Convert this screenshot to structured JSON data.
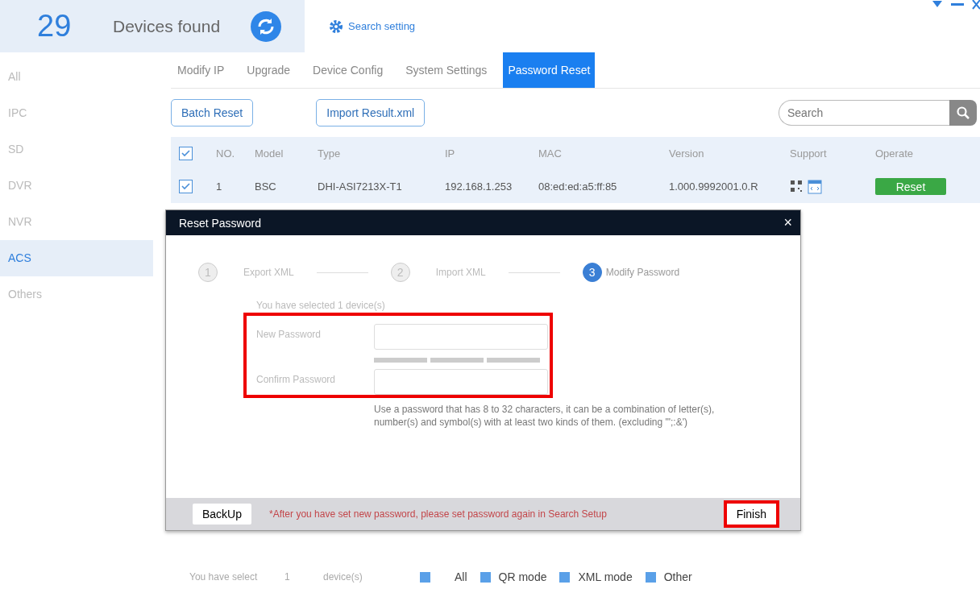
{
  "header": {
    "count": "29",
    "label": "Devices found",
    "search_setting": "Search setting"
  },
  "sidebar": {
    "items": [
      {
        "label": "All",
        "selected": false
      },
      {
        "label": "IPC",
        "selected": false
      },
      {
        "label": "SD",
        "selected": false
      },
      {
        "label": "DVR",
        "selected": false
      },
      {
        "label": "NVR",
        "selected": false
      },
      {
        "label": "ACS",
        "selected": true
      },
      {
        "label": "Others",
        "selected": false
      }
    ]
  },
  "tabs": [
    {
      "label": "Modify IP",
      "selected": false
    },
    {
      "label": "Upgrade",
      "selected": false
    },
    {
      "label": "Device Config",
      "selected": false
    },
    {
      "label": "System Settings",
      "selected": false
    },
    {
      "label": "Password Reset",
      "selected": true
    }
  ],
  "toolbar": {
    "buttons": [
      "Batch Reset",
      "Import Result.xml"
    ],
    "search": {
      "placeholder": "Search"
    }
  },
  "table": {
    "all_checked": true,
    "columns": [
      "NO.",
      "Model",
      "Type",
      "IP",
      "MAC",
      "Version",
      "Support",
      "Operate"
    ],
    "rows": [
      {
        "checked": true,
        "no": "1",
        "model": "BSC",
        "type": "DHI-ASI7213X-T1",
        "ip": "192.168.1.253",
        "mac": "08:ed:ed:a5:ff:85",
        "version": "1.000.9992001.0.R",
        "action": "Reset"
      }
    ]
  },
  "dialog": {
    "title": "Reset Password",
    "close": "×",
    "steps": [
      {
        "number": "1",
        "label": "Export XML",
        "selected": false
      },
      {
        "number": "2",
        "label": "Import XML",
        "selected": false
      },
      {
        "number": "3",
        "label": "Modify Password",
        "selected": true
      }
    ],
    "selected_info": "You have selected 1 device(s)",
    "fields": [
      {
        "label": "New Password",
        "kind": "strength"
      },
      {
        "label": "Confirm Password",
        "kind": "plain"
      }
    ],
    "hint": "Use a password that has 8 to 32 characters, it can be a combination of letter(s), number(s) and symbol(s) with at least two kinds of them. (excluding '\";:&')",
    "backup": "BackUp",
    "notice": "*After you have set new password, please set password again in Search Setup",
    "finish": "Finish"
  },
  "footer": {
    "prefix": "You have select",
    "count": "1",
    "suffix": "device(s)",
    "legend": [
      "All",
      "QR mode",
      "XML mode",
      "Other"
    ]
  }
}
